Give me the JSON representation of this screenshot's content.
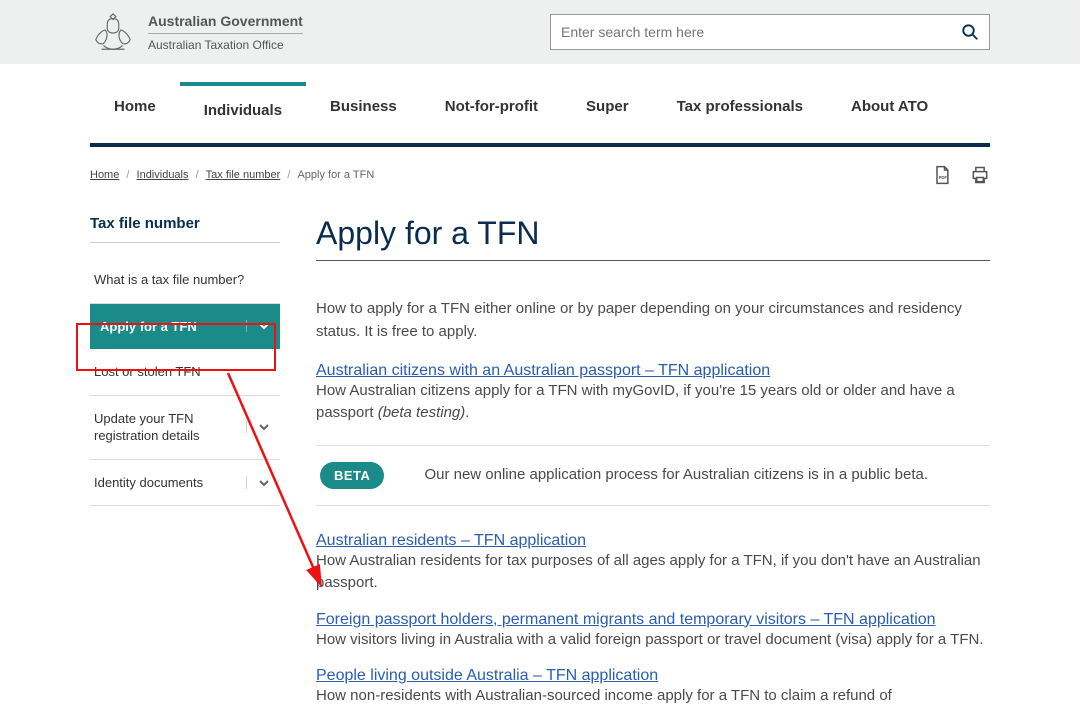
{
  "brand": {
    "gov": "Australian Government",
    "ato": "Australian Taxation Office"
  },
  "search": {
    "placeholder": "Enter search term here"
  },
  "nav": {
    "items": [
      "Home",
      "Individuals",
      "Business",
      "Not-for-profit",
      "Super",
      "Tax professionals",
      "About ATO"
    ],
    "active_index": 1
  },
  "breadcrumb": {
    "links": [
      "Home",
      "Individuals",
      "Tax file number"
    ],
    "current": "Apply for a TFN",
    "sep": "/"
  },
  "sidebar": {
    "title": "Tax file number",
    "items": [
      {
        "label": "What is a tax file number?",
        "expandable": false,
        "active": false
      },
      {
        "label": "Apply for a TFN",
        "expandable": true,
        "active": true
      },
      {
        "label": "Lost or stolen TFN",
        "expandable": false,
        "active": false
      },
      {
        "label": "Update your TFN registration details",
        "expandable": true,
        "active": false
      },
      {
        "label": "Identity documents",
        "expandable": true,
        "active": false
      }
    ]
  },
  "page": {
    "title": "Apply for a TFN",
    "intro": "How to apply for a TFN either online or by paper depending on your circumstances and residency status. It is free to apply.",
    "sections": [
      {
        "link": "Australian citizens with an Australian passport – TFN application",
        "desc_before": "How Australian citizens apply for a TFN with myGovID, if you're 15  years old or older and have a passport ",
        "desc_em": "(beta testing)",
        "desc_after": "."
      },
      {
        "link": "Australian residents – TFN application",
        "desc_before": "How Australian residents for tax purposes of all ages apply for a TFN, if you don't have an Australian passport.",
        "desc_em": "",
        "desc_after": ""
      },
      {
        "link": "Foreign passport holders, permanent migrants and temporary visitors – TFN application",
        "desc_before": "How visitors living in Australia with a valid foreign passport or travel document (visa) apply for a TFN.",
        "desc_em": "",
        "desc_after": ""
      },
      {
        "link": "People living outside Australia – TFN application",
        "desc_before": "How non-residents with Australian-sourced income apply for a TFN to claim a refund of",
        "desc_em": "",
        "desc_after": ""
      }
    ],
    "beta": {
      "pill": "BETA",
      "text": "Our new online application process for Australian citizens is in a public beta."
    }
  }
}
